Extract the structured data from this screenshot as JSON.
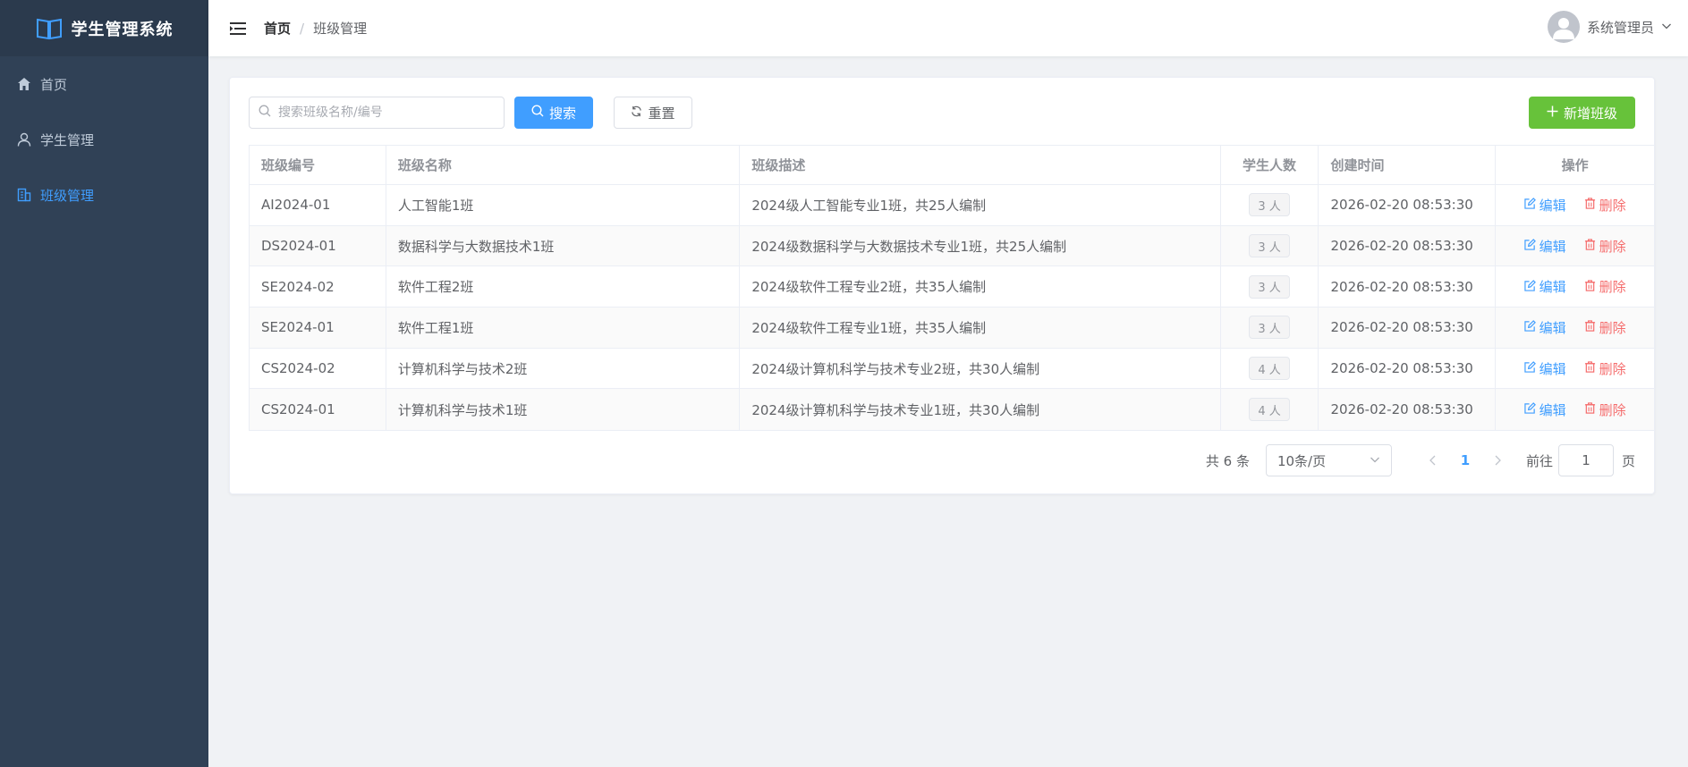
{
  "app": {
    "title": "学生管理系统"
  },
  "sidebar": {
    "items": [
      {
        "label": "首页",
        "icon": "home-icon",
        "active": false
      },
      {
        "label": "学生管理",
        "icon": "user-icon",
        "active": false
      },
      {
        "label": "班级管理",
        "icon": "building-icon",
        "active": true
      }
    ]
  },
  "header": {
    "breadcrumb": {
      "home": "首页",
      "separator": "/",
      "current": "班级管理"
    },
    "user": {
      "name": "系统管理员"
    }
  },
  "toolbar": {
    "search_placeholder": "搜索班级名称/编号",
    "search_value": "",
    "search_label": "搜索",
    "reset_label": "重置",
    "add_label": "新增班级"
  },
  "table": {
    "columns": [
      "班级编号",
      "班级名称",
      "班级描述",
      "学生人数",
      "创建时间",
      "操作"
    ],
    "rows": [
      {
        "code": "AI2024-01",
        "name": "人工智能1班",
        "desc": "2024级人工智能专业1班，共25人编制",
        "count": "3 人",
        "created": "2026-02-20 08:53:30"
      },
      {
        "code": "DS2024-01",
        "name": "数据科学与大数据技术1班",
        "desc": "2024级数据科学与大数据技术专业1班，共25人编制",
        "count": "3 人",
        "created": "2026-02-20 08:53:30"
      },
      {
        "code": "SE2024-02",
        "name": "软件工程2班",
        "desc": "2024级软件工程专业2班，共35人编制",
        "count": "3 人",
        "created": "2026-02-20 08:53:30"
      },
      {
        "code": "SE2024-01",
        "name": "软件工程1班",
        "desc": "2024级软件工程专业1班，共35人编制",
        "count": "3 人",
        "created": "2026-02-20 08:53:30"
      },
      {
        "code": "CS2024-02",
        "name": "计算机科学与技术2班",
        "desc": "2024级计算机科学与技术专业2班，共30人编制",
        "count": "4 人",
        "created": "2026-02-20 08:53:30"
      },
      {
        "code": "CS2024-01",
        "name": "计算机科学与技术1班",
        "desc": "2024级计算机科学与技术专业1班，共30人编制",
        "count": "4 人",
        "created": "2026-02-20 08:53:30"
      }
    ],
    "edit_label": "编辑",
    "delete_label": "删除"
  },
  "pagination": {
    "total": "共 6 条",
    "page_size": "10条/页",
    "current_page": "1",
    "goto_label": "前往",
    "goto_value": "1",
    "page_suffix": "页"
  },
  "colors": {
    "sidebar_bg": "#304156",
    "primary": "#409eff",
    "success": "#67c23a",
    "danger": "#f56c6c"
  }
}
